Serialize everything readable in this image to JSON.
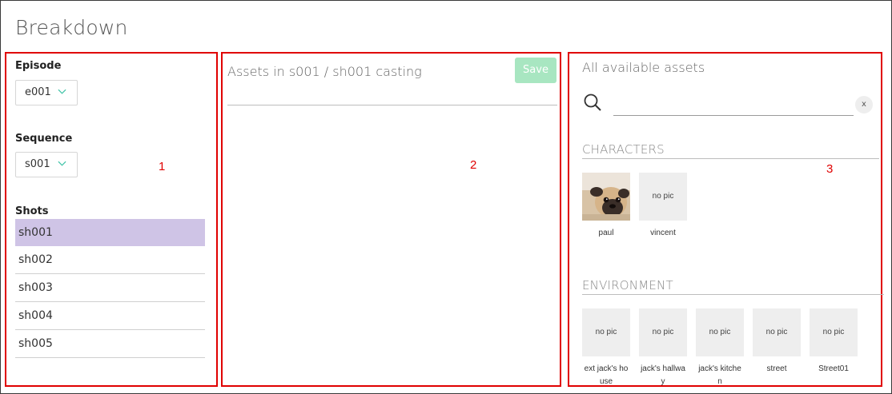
{
  "page": {
    "title": "Breakdown"
  },
  "markers": [
    "1",
    "2",
    "3"
  ],
  "panel1": {
    "episode_label": "Episode",
    "episode_value": "e001",
    "sequence_label": "Sequence",
    "sequence_value": "s001",
    "shots_label": "Shots",
    "shots": [
      "sh001",
      "sh002",
      "sh003",
      "sh004",
      "sh005"
    ],
    "selected_shot": "sh001"
  },
  "panel2": {
    "title": "Assets in s001 / sh001 casting",
    "save_label": "Save"
  },
  "panel3": {
    "title": "All available assets",
    "search": {
      "value": "",
      "clear_label": "x"
    },
    "characters": {
      "title": "CHARACTERS",
      "assets": [
        {
          "name": "paul",
          "thumb": "photo"
        },
        {
          "name": "vincent",
          "thumb": "no pic"
        }
      ]
    },
    "environment": {
      "title": "ENVIRONMENT",
      "assets": [
        {
          "name": "ext jack's house",
          "thumb": "no pic"
        },
        {
          "name": "jack's hallway",
          "thumb": "no pic"
        },
        {
          "name": "jack's kitchen",
          "thumb": "no pic"
        },
        {
          "name": "street",
          "thumb": "no pic"
        },
        {
          "name": "Street01",
          "thumb": "no pic"
        }
      ]
    }
  },
  "colors": {
    "marker": "#e00000",
    "selected_row": "#cfc4e6",
    "save_button": "#a8e6c1",
    "chevron": "#3fc3a7"
  }
}
